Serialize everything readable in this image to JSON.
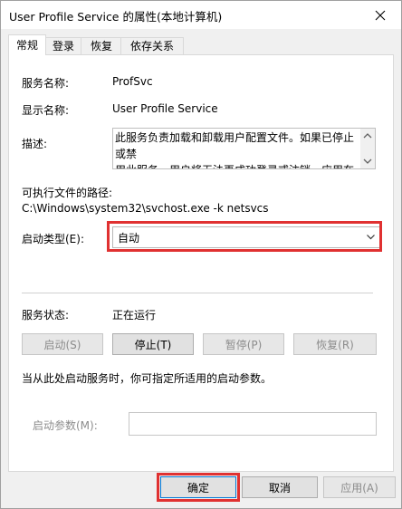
{
  "window": {
    "title": "User Profile Service 的属性(本地计算机)"
  },
  "tabs": [
    {
      "label": "常规",
      "active": true
    },
    {
      "label": "登录",
      "active": false
    },
    {
      "label": "恢复",
      "active": false
    },
    {
      "label": "依存关系",
      "active": false
    }
  ],
  "general": {
    "service_name_label": "服务名称:",
    "service_name": "ProfSvc",
    "display_name_label": "显示名称:",
    "display_name": "User Profile Service",
    "description_label": "描述:",
    "description": "此服务负责加载和卸载用户配置文件。如果已停止或禁\n用此服务，用户将无法再成功登录或注销，应用在获取",
    "exe_path_label": "可执行文件的路径:",
    "exe_path": "C:\\Windows\\system32\\svchost.exe -k netsvcs",
    "startup_type_label": "启动类型(E):",
    "startup_type": "自动",
    "status_label": "服务状态:",
    "status": "正在运行",
    "buttons": {
      "start": "启动(S)",
      "stop": "停止(T)",
      "pause": "暂停(P)",
      "resume": "恢复(R)"
    },
    "hint": "当从此处启动服务时，你可指定所适用的启动参数。",
    "params_label": "启动参数(M):",
    "params_value": ""
  },
  "footer": {
    "ok": "确定",
    "cancel": "取消",
    "apply": "应用(A)"
  },
  "colors": {
    "highlight": "#e03131",
    "focus": "#0078d7"
  },
  "icons": {
    "close": "close-icon",
    "scroll_up": "chevron-up-icon",
    "scroll_down": "chevron-down-icon",
    "dropdown": "chevron-down-icon"
  }
}
